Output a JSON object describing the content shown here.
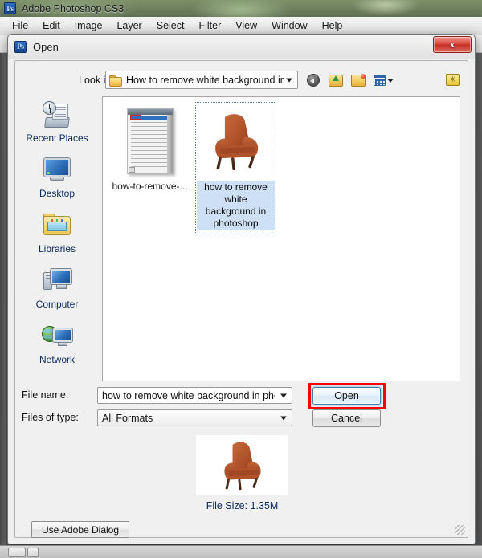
{
  "app": {
    "title": "Adobe Photoshop CS3",
    "logo_text": "Ps",
    "logo_icon": "photoshop-icon",
    "menu": [
      {
        "label": "File"
      },
      {
        "label": "Edit"
      },
      {
        "label": "Image"
      },
      {
        "label": "Layer"
      },
      {
        "label": "Select"
      },
      {
        "label": "Filter"
      },
      {
        "label": "View"
      },
      {
        "label": "Window"
      },
      {
        "label": "Help"
      }
    ]
  },
  "dialog": {
    "title": "Open",
    "logo_text": "Ps",
    "close_label": "x",
    "close_icon": "close-icon",
    "lookin": {
      "label": "Look in:",
      "value": "How to remove white background in Photosho",
      "folder_icon": "folder-icon",
      "dropdown_icon": "chevron-down-icon"
    },
    "toolbar": [
      {
        "name": "back-button",
        "icon": "back-arrow-icon",
        "tooltip": "Back"
      },
      {
        "name": "up-folder-button",
        "icon": "up-folder-icon",
        "tooltip": "Up One Level"
      },
      {
        "name": "new-folder-button",
        "icon": "new-folder-icon",
        "tooltip": "Create New Folder"
      },
      {
        "name": "views-button",
        "icon": "views-grid-icon",
        "tooltip": "Views"
      }
    ],
    "tools_button": {
      "name": "tools-folder-button",
      "icon": "tools-folder-icon"
    },
    "places": [
      {
        "label": "Recent Places",
        "icon": "recent-places-icon"
      },
      {
        "label": "Desktop",
        "icon": "desktop-monitor-icon"
      },
      {
        "label": "Libraries",
        "icon": "libraries-folder-icon"
      },
      {
        "label": "Computer",
        "icon": "computer-icon"
      },
      {
        "label": "Network",
        "icon": "network-globe-icon"
      }
    ],
    "files": [
      {
        "label": "how-to-remove-...",
        "thumb": "screenshot-thumbnail",
        "selected": false
      },
      {
        "label": "how to remove white background in photoshop",
        "thumb": "orange-chair-photo",
        "selected": true
      }
    ],
    "form": {
      "filename_label": "File name:",
      "filename_value": "how to remove white background in photoshop",
      "filetype_label": "Files of type:",
      "filetype_value": "All Formats",
      "dropdown_icon": "chevron-down-icon"
    },
    "buttons": {
      "open": "Open",
      "cancel": "Cancel",
      "adobe_dialog": "Use Adobe Dialog"
    },
    "highlight": {
      "target": "open-button",
      "color": "#ff0000"
    },
    "preview": {
      "image": "orange-chair-photo",
      "file_size_text": "File Size: 1.35M"
    },
    "resize_grip_icon": "resize-grip-icon"
  },
  "colors": {
    "accent_blue": "#3c7fb1",
    "selection_blue": "#cde0f5",
    "annotation_red": "#ff0000",
    "close_red": "#c32f26",
    "label_navy": "#0b2a5e",
    "chair_orange": "#b5532a"
  }
}
